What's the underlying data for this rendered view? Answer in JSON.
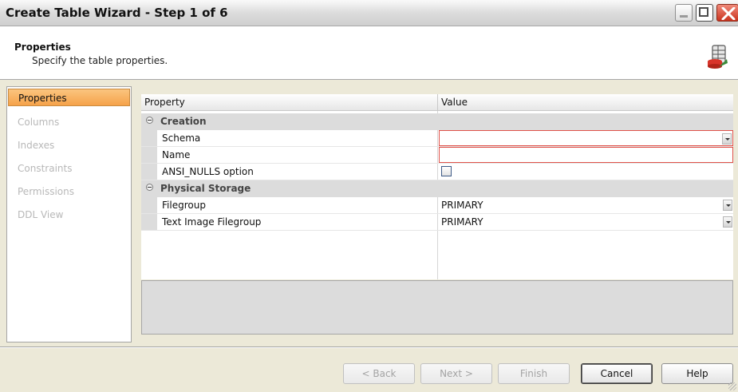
{
  "window": {
    "title": "Create Table Wizard - Step 1 of 6"
  },
  "header": {
    "title": "Properties",
    "subtitle": "Specify the table properties.",
    "icon": "table-properties-icon"
  },
  "nav": {
    "items": [
      {
        "label": "Properties",
        "active": true
      },
      {
        "label": "Columns",
        "active": false
      },
      {
        "label": "Indexes",
        "active": false
      },
      {
        "label": "Constraints",
        "active": false
      },
      {
        "label": "Permissions",
        "active": false
      },
      {
        "label": "DDL View",
        "active": false
      }
    ]
  },
  "grid": {
    "columns": {
      "property": "Property",
      "value": "Value"
    },
    "categories": [
      {
        "label": "Creation",
        "rows": [
          {
            "name": "Schema",
            "value": "",
            "editor": "dropdown",
            "invalid": true
          },
          {
            "name": "Name",
            "value": "",
            "editor": "text",
            "invalid": true
          },
          {
            "name": "ANSI_NULLS option",
            "value": "",
            "editor": "checkbox",
            "checked": false
          }
        ]
      },
      {
        "label": "Physical Storage",
        "rows": [
          {
            "name": "Filegroup",
            "value": "PRIMARY",
            "editor": "dropdown"
          },
          {
            "name": "Text Image Filegroup",
            "value": "PRIMARY",
            "editor": "dropdown"
          }
        ]
      }
    ]
  },
  "buttons": {
    "back": "< Back",
    "next": "Next >",
    "finish": "Finish",
    "cancel": "Cancel",
    "help": "Help"
  },
  "colors": {
    "accent": "#f5a24a",
    "invalid_border": "#e0524a",
    "close_button": "#c9331f"
  }
}
